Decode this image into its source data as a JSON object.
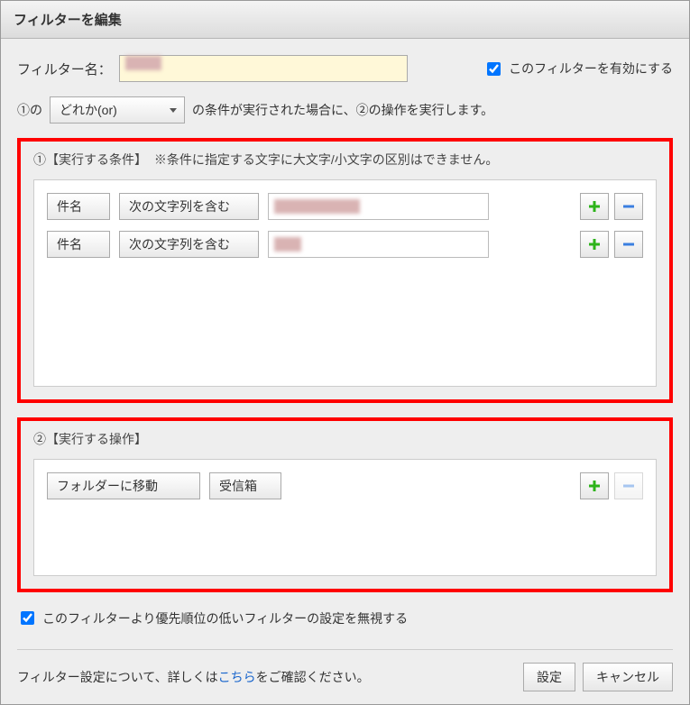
{
  "dialog": {
    "title": "フィルターを編集"
  },
  "filterName": {
    "label": "フィルター名：",
    "value": ""
  },
  "enable": {
    "label": "このフィルターを有効にする",
    "checked": true
  },
  "sentence": {
    "prefix": "①の",
    "selector": "どれか(or)",
    "suffix": "の条件が実行された場合に、②の操作を実行します。"
  },
  "conditions": {
    "title": "①【実行する条件】",
    "note": "※条件に指定する文字に大文字/小文字の区別はできません。",
    "rules": [
      {
        "field": "件名",
        "op": "次の文字列を含む",
        "value": ""
      },
      {
        "field": "件名",
        "op": "次の文字列を含む",
        "value": ""
      }
    ]
  },
  "actions": {
    "title": "②【実行する操作】",
    "rules": [
      {
        "action": "フォルダーに移動",
        "target": "受信箱"
      }
    ]
  },
  "priorityIgnore": {
    "label": "このフィルターより優先順位の低いフィルターの設定を無視する",
    "checked": true
  },
  "footer": {
    "text1": "フィルター設定について、詳しくは",
    "link": "こちら",
    "text2": "をご確認ください。",
    "ok": "設定",
    "cancel": "キャンセル"
  }
}
